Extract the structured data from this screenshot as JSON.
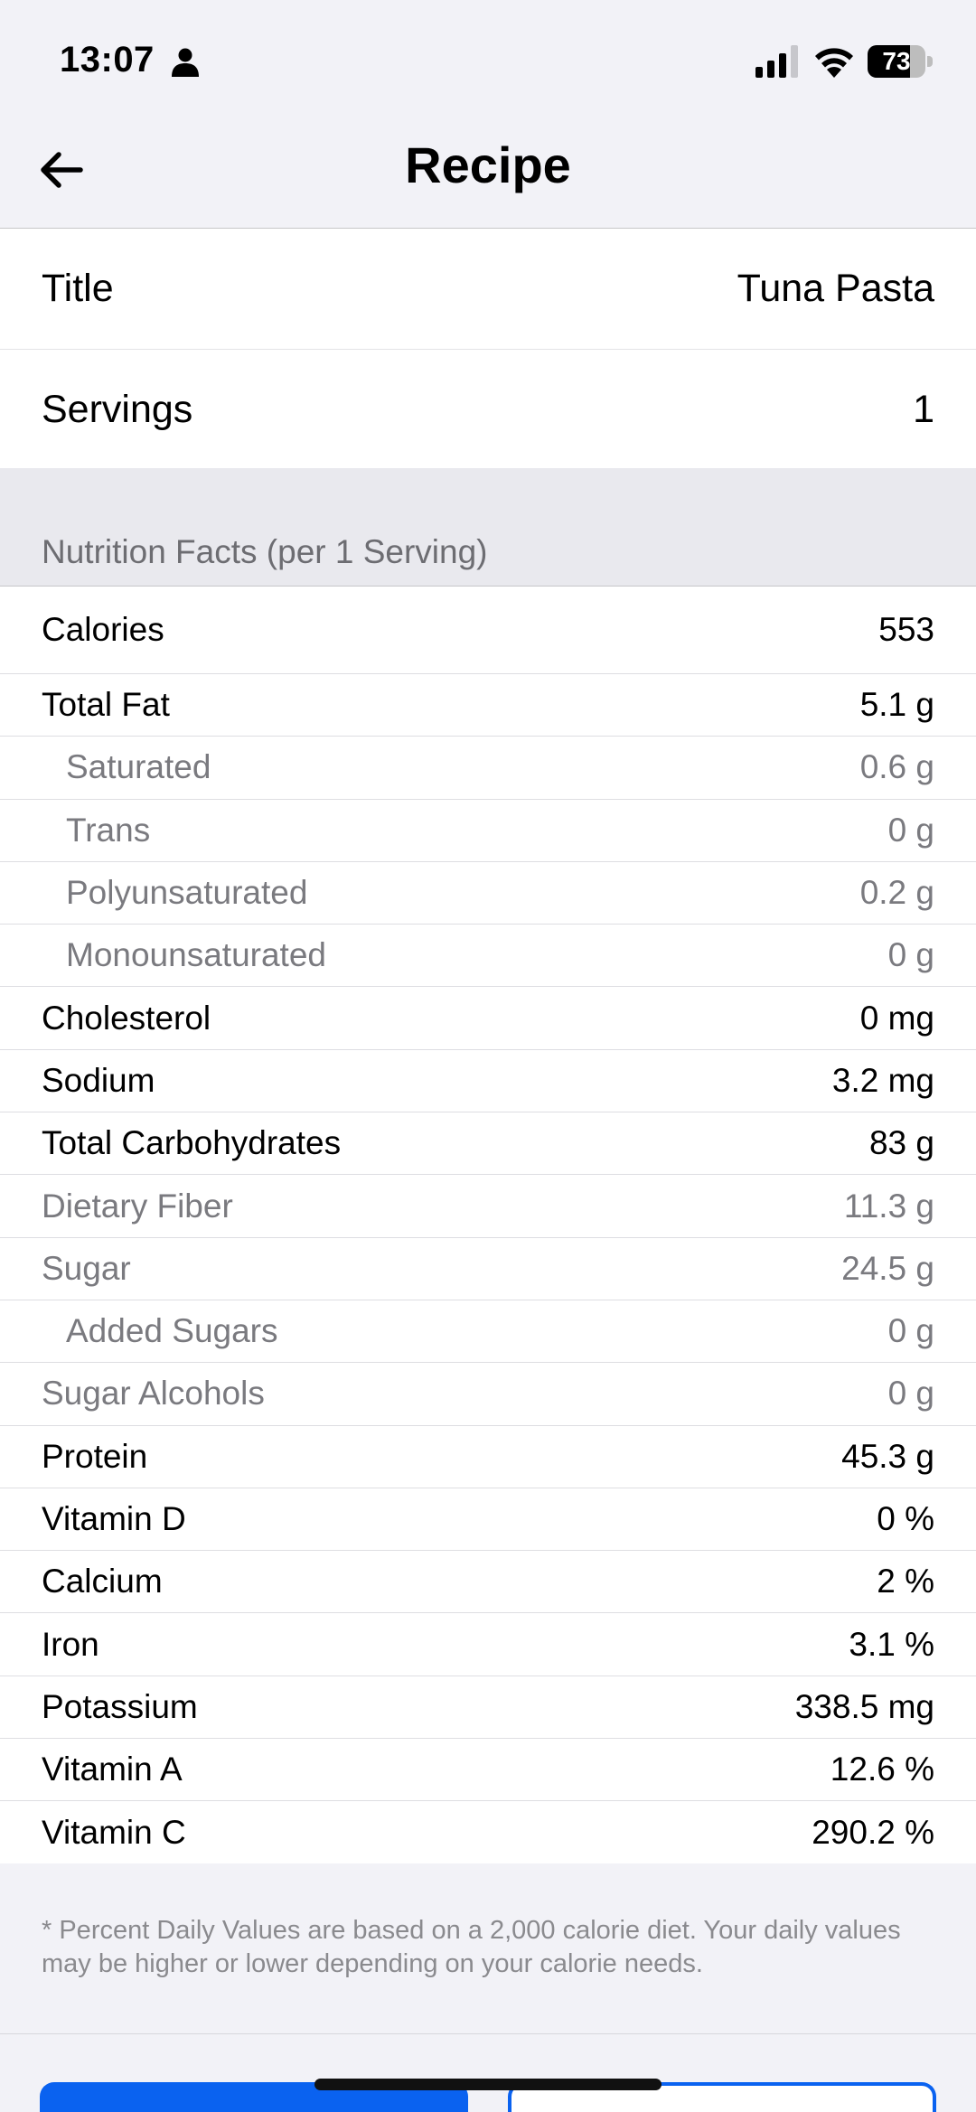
{
  "status_bar": {
    "time": "13:07",
    "battery": "73",
    "battery_level": 0.73,
    "icons": [
      "person-icon",
      "signal-icon",
      "wifi-icon",
      "battery-icon"
    ]
  },
  "nav": {
    "title": "Recipe",
    "back_icon": "arrow-left-icon"
  },
  "recipe": {
    "title_label": "Title",
    "title_value": "Tuna Pasta",
    "servings_label": "Servings",
    "servings_value": "1"
  },
  "nutrition": {
    "header": "Nutrition Facts (per 1 Serving)",
    "rows": [
      {
        "label": "Calories",
        "value": "553"
      },
      {
        "label": "Total Fat",
        "value": "5.1 g"
      },
      {
        "label": "Saturated",
        "value": "0.6 g"
      },
      {
        "label": "Trans",
        "value": "0 g"
      },
      {
        "label": "Polyunsaturated",
        "value": "0.2 g"
      },
      {
        "label": "Monounsaturated",
        "value": "0 g"
      },
      {
        "label": "Cholesterol",
        "value": "0 mg"
      },
      {
        "label": "Sodium",
        "value": "3.2 mg"
      },
      {
        "label": "Total Carbohydrates",
        "value": "83 g"
      },
      {
        "label": "Dietary Fiber",
        "value": "11.3 g"
      },
      {
        "label": "Sugar",
        "value": "24.5 g"
      },
      {
        "label": "Added Sugars",
        "value": "0 g"
      },
      {
        "label": "Sugar Alcohols",
        "value": "0 g"
      },
      {
        "label": "Protein",
        "value": "45.3 g"
      },
      {
        "label": "Vitamin D",
        "value": "0 %"
      },
      {
        "label": "Calcium",
        "value": "2 %"
      },
      {
        "label": "Iron",
        "value": "3.1 %"
      },
      {
        "label": "Potassium",
        "value": "338.5 mg"
      },
      {
        "label": "Vitamin A",
        "value": "12.6 %"
      },
      {
        "label": "Vitamin C",
        "value": "290.2 %"
      }
    ]
  },
  "footnote": "* Percent Daily Values are based on a 2,000 calorie diet.  Your daily values may be higher or lower depending on your calorie needs.",
  "colors": {
    "accent": "#0a62f0",
    "background": "#f2f2f7",
    "secondary_text": "#7a7a7f"
  }
}
